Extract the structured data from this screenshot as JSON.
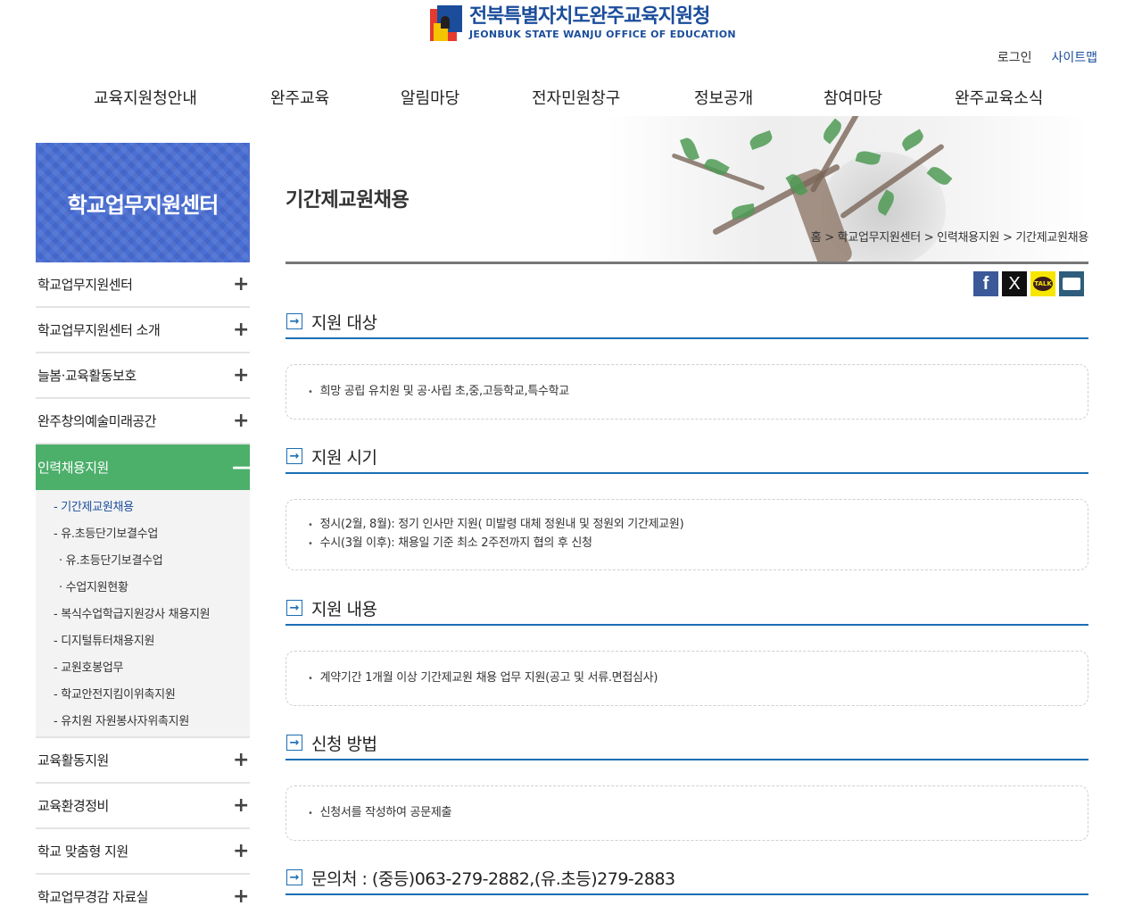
{
  "header": {
    "org_ko": "전북특별자치도완주교육지원청",
    "org_en": "JEONBUK STATE WANJU OFFICE OF EDUCATION",
    "login": "로그인",
    "sitemap": "사이트맵"
  },
  "gnb": [
    "교육지원청안내",
    "완주교육",
    "알림마당",
    "전자민원창구",
    "정보공개",
    "참여마당",
    "완주교육소식"
  ],
  "sidebar": {
    "title": "학교업무지원센터",
    "items_top": [
      "학교업무지원센터",
      "학교업무지원센터 소개",
      "늘봄·교육활동보호",
      "완주창의예술미래공간"
    ],
    "active": "인력채용지원",
    "sub": [
      {
        "label": "- 기간제교원채용",
        "current": true,
        "depth": 2
      },
      {
        "label": "- 유.초등단기보결수업",
        "current": false,
        "depth": 2
      },
      {
        "label": "· 유.초등단기보결수업",
        "current": false,
        "depth": 3
      },
      {
        "label": "· 수업지원현황",
        "current": false,
        "depth": 3
      },
      {
        "label": "- 복식수업학급지원강사 채용지원",
        "current": false,
        "depth": 2
      },
      {
        "label": "- 디지털튜터채용지원",
        "current": false,
        "depth": 2
      },
      {
        "label": "- 교원호봉업무",
        "current": false,
        "depth": 2
      },
      {
        "label": "- 학교안전지킴이위촉지원",
        "current": false,
        "depth": 2
      },
      {
        "label": "- 유치원 자원봉사자위촉지원",
        "current": false,
        "depth": 2
      }
    ],
    "items_bottom": [
      "교육활동지원",
      "교육환경정비",
      "학교 맞춤형 지원",
      "학교업무경감 자료실"
    ]
  },
  "page": {
    "title": "기간제교원채용",
    "breadcrumb": "홈 > 학교업무지원센터 > 인력채용지원 > 기간제교원채용"
  },
  "share": {
    "facebook": "f",
    "x": "X",
    "talk": "TALK"
  },
  "sections": [
    {
      "title": "지원 대상",
      "lines": [
        "희망 공립 유치원 및 공·사립 초,중,고등학교,특수학교"
      ]
    },
    {
      "title": "지원 시기",
      "lines": [
        "정시(2월, 8월): 정기 인사만 지원( 미발령 대체 정원내 및 정원외 기간제교원)",
        "수시(3월 이후): 채용일 기준 최소 2주전까지 협의 후 신청"
      ]
    },
    {
      "title": "지원 내용",
      "lines": [
        "계약기간 1개월 이상 기간제교원 채용 업무 지원(공고 및 서류.면접심사)"
      ]
    },
    {
      "title": "신청 방법",
      "lines": [
        "신청서를 작성하여 공문제출"
      ]
    },
    {
      "title": "문의처 : (중등)063-279-2882,(유.초등)279-2883",
      "lines": []
    }
  ],
  "colors": {
    "brand": "#1b4d9b",
    "active_green": "#4caf6a",
    "section_line": "#1b6eb5"
  }
}
